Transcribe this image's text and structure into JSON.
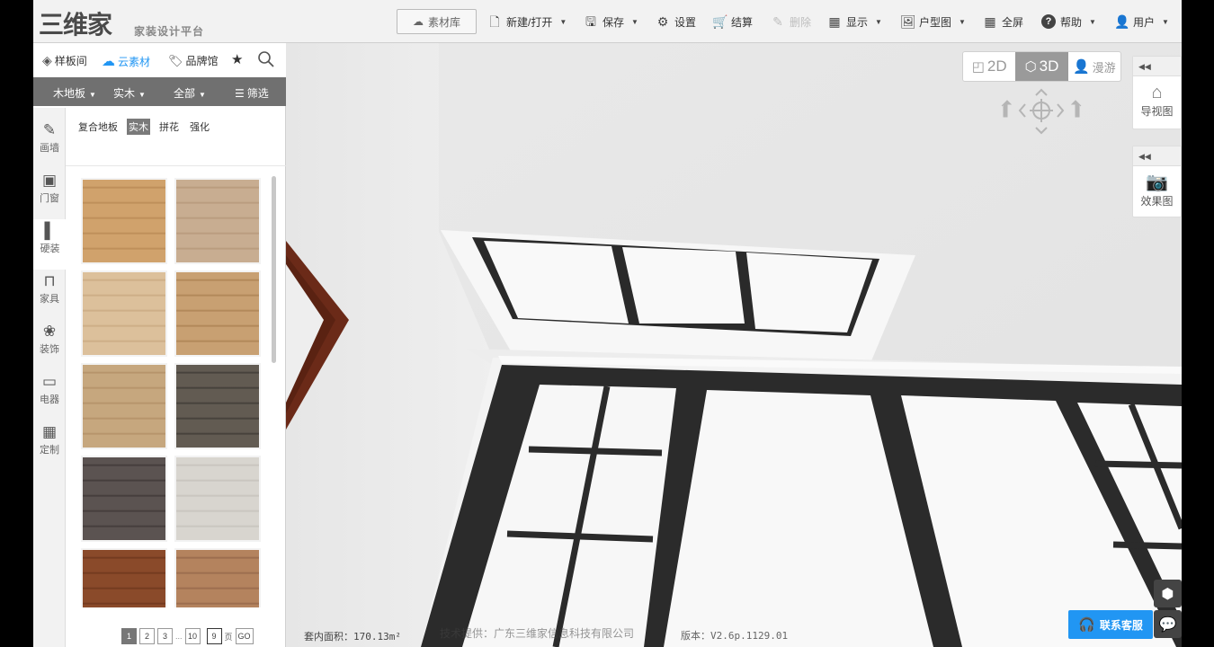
{
  "logo": {
    "mark": "三维家",
    "subtitle": "家装设计平台"
  },
  "toolbar": {
    "material_library": "素材库",
    "new_open": "新建/打开",
    "save": "保存",
    "settings": "设置",
    "checkout": "结算",
    "delete": "删除",
    "display": "显示",
    "floorplan": "户型图",
    "fullscreen": "全屏",
    "help": "帮助",
    "user": "用户"
  },
  "panel": {
    "tabs": {
      "samples": "样板间",
      "cloud": "云素材",
      "brand": "品牌馆"
    },
    "filters": {
      "category": "木地板",
      "material": "实木",
      "scope": "全部",
      "filter": "筛选"
    },
    "subfilters": [
      "复合地板",
      "实木",
      "拼花",
      "强化"
    ],
    "active_subfilter": "实木"
  },
  "categories": [
    "画墙",
    "门窗",
    "硬装",
    "家具",
    "装饰",
    "电器",
    "定制"
  ],
  "active_category": "硬装",
  "tiles": [
    {
      "c1": "#d0a26c",
      "c2": "#b98955"
    },
    {
      "c1": "#c8ad91",
      "c2": "#b69779"
    },
    {
      "c1": "#dcc09b",
      "c2": "#c9a981"
    },
    {
      "c1": "#c8a072",
      "c2": "#ab8152"
    },
    {
      "c1": "#c6a77e",
      "c2": "#b28f66"
    },
    {
      "c1": "#625b52",
      "c2": "#3e3a35"
    },
    {
      "c1": "#5b5351",
      "c2": "#3f3837"
    },
    {
      "c1": "#d8d5cf",
      "c2": "#c5c1ba"
    },
    {
      "c1": "#8a4a2a",
      "c2": "#6d361c"
    },
    {
      "c1": "#b4835e",
      "c2": "#95674a"
    }
  ],
  "pager": {
    "pages": [
      "1",
      "2",
      "3",
      "...",
      "10"
    ],
    "current": "1",
    "input": "9",
    "suffix": "页",
    "go": "GO"
  },
  "view": {
    "mode_2d": "2D",
    "mode_3d": "3D",
    "walk": "漫游",
    "active": "3D"
  },
  "right": {
    "navigator": "导视图",
    "render": "效果图"
  },
  "status": {
    "area_label": "套内面积：",
    "area_value": "170.13m²",
    "credit": "技术提供：广东三维家信息科技有限公司",
    "version": "版本：V2.6p.1129.01"
  },
  "contact": "联系客服",
  "icons": [
    "cloud-icon",
    "file-icon",
    "save-icon",
    "gear-icon",
    "cart-icon",
    "eraser-icon",
    "grid-icon",
    "image-icon",
    "fullscreen-icon",
    "help-icon",
    "user-icon",
    "star-icon",
    "search-icon",
    "home-icon",
    "camera-icon",
    "cube-icon",
    "chat-icon",
    "headset-icon"
  ]
}
